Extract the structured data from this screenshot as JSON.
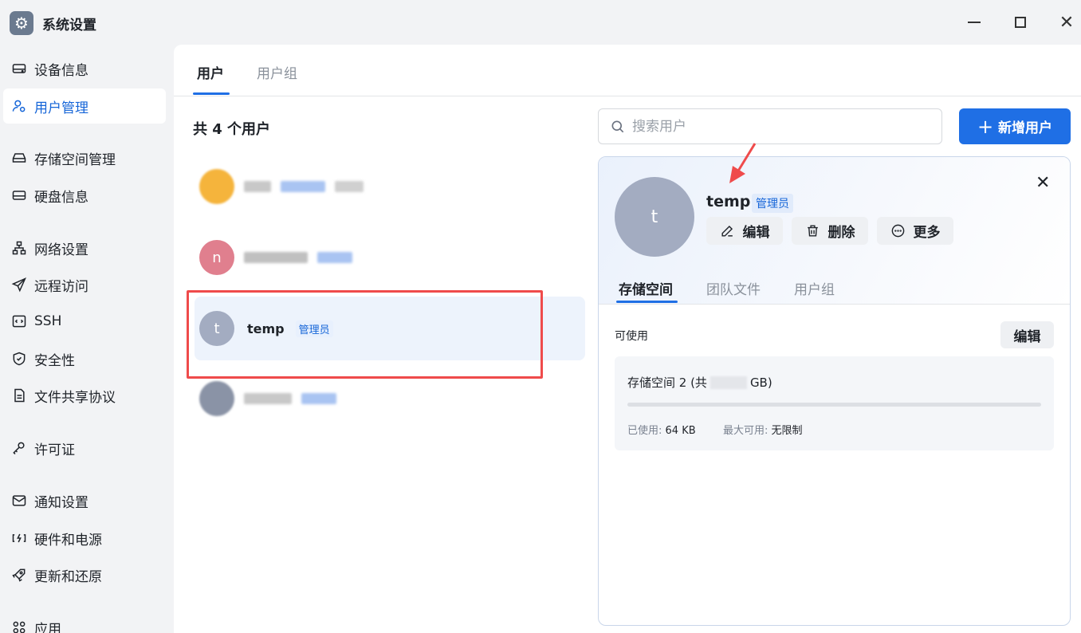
{
  "window": {
    "title": "系统设置",
    "app_icon": "gear-icon"
  },
  "sidebar": {
    "items": [
      {
        "label": "设备信息",
        "icon": "drive-icon",
        "active": false
      },
      {
        "label": "用户管理",
        "icon": "user-manage-icon",
        "active": true
      },
      {
        "label": "存储空间管理",
        "icon": "storage-icon",
        "active": false
      },
      {
        "label": "硬盘信息",
        "icon": "disk-icon",
        "active": false
      },
      {
        "label": "网络设置",
        "icon": "network-icon",
        "active": false
      },
      {
        "label": "远程访问",
        "icon": "send-icon",
        "active": false
      },
      {
        "label": "SSH",
        "icon": "code-icon",
        "active": false
      },
      {
        "label": "安全性",
        "icon": "shield-icon",
        "active": false
      },
      {
        "label": "文件共享协议",
        "icon": "file-icon",
        "active": false
      },
      {
        "label": "许可证",
        "icon": "key-icon",
        "active": false
      },
      {
        "label": "通知设置",
        "icon": "mail-icon",
        "active": false
      },
      {
        "label": "硬件和电源",
        "icon": "power-icon",
        "active": false
      },
      {
        "label": "更新和还原",
        "icon": "rocket-icon",
        "active": false
      },
      {
        "label": "应用",
        "icon": "apps-icon",
        "active": false
      }
    ]
  },
  "tabs": [
    {
      "label": "用户",
      "active": true
    },
    {
      "label": "用户组",
      "active": false
    }
  ],
  "user_list": {
    "count_label": "共 4 个用户",
    "users": [
      {
        "initial": "",
        "name": "",
        "role": "",
        "avatar_color": "#f5b43c",
        "blurred": true
      },
      {
        "initial": "n",
        "name": "",
        "role": "",
        "avatar_color": "#e07f8e",
        "blurred": true
      },
      {
        "initial": "t",
        "name": "temp",
        "role": "管理员",
        "avatar_color": "#a3acc1",
        "blurred": false,
        "selected": true
      },
      {
        "initial": "",
        "name": "",
        "role": "",
        "avatar_color": "#8a93a6",
        "blurred": true
      }
    ]
  },
  "search": {
    "placeholder": "搜索用户",
    "value": ""
  },
  "add_user_button": {
    "label": "新增用户"
  },
  "detail": {
    "initial": "t",
    "name": "temp",
    "role": "管理员",
    "actions": {
      "edit": "编辑",
      "delete": "删除",
      "more": "更多"
    },
    "tabs": [
      {
        "label": "存储空间",
        "active": true
      },
      {
        "label": "团队文件",
        "active": false
      },
      {
        "label": "用户组",
        "active": false
      }
    ],
    "available_label": "可使用",
    "edit_label": "编辑",
    "storage": {
      "title_prefix": "存储空间 2 (共",
      "title_suffix": "GB)",
      "used_label": "已使用:",
      "used_value": "64 KB",
      "max_label": "最大可用:",
      "max_value": "无限制",
      "used_fraction": 0.0
    }
  },
  "colors": {
    "accent": "#1f6fe5",
    "highlight": "#ef4b4b",
    "sidebar_bg": "#f2f3f5"
  }
}
